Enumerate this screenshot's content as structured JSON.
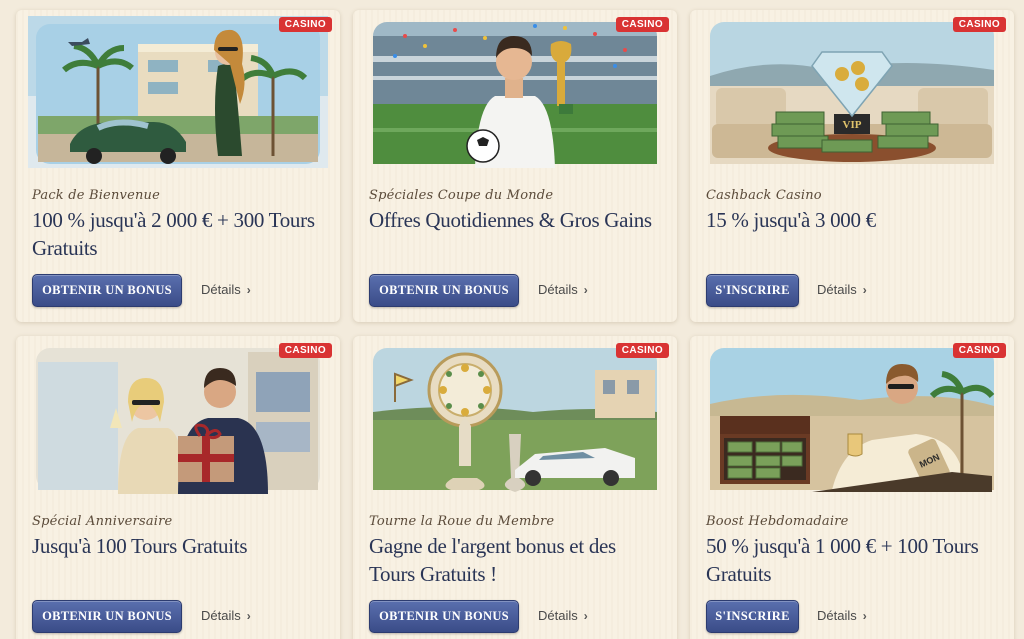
{
  "badge_label": "CASINO",
  "cards": [
    {
      "subtitle": "Pack de Bienvenue",
      "title": "100 % jusqu'à 2 000 € + 300 Tours Gratuits",
      "button": "OBTENIR UN BONUS",
      "details": "Détails"
    },
    {
      "subtitle": "Spéciales Coupe du Monde",
      "title": "Offres Quotidiennes & Gros Gains",
      "button": "OBTENIR UN BONUS",
      "details": "Détails"
    },
    {
      "subtitle": "Cashback Casino",
      "title": "15 % jusqu'à 3 000 €",
      "button": "S'INSCRIRE",
      "details": "Détails"
    },
    {
      "subtitle": "Spécial Anniversaire",
      "title": "Jusqu'à 100 Tours Gratuits",
      "button": "OBTENIR UN BONUS",
      "details": "Détails"
    },
    {
      "subtitle": "Tourne la Roue du Membre",
      "title": "Gagne de l'argent bonus et des Tours Gratuits !",
      "button": "OBTENIR UN BONUS",
      "details": "Détails"
    },
    {
      "subtitle": "Boost Hebdomadaire",
      "title": "50 % jusqu'à 1 000 € + 100 Tours Gratuits",
      "button": "S'INSCRIRE",
      "details": "Détails"
    }
  ],
  "vip_sign": "VIP",
  "mon_sign": "MON",
  "icons": {
    "details": "chevron-right-icon"
  },
  "colors": {
    "badge": "#d93333",
    "button": "#3f518e",
    "title": "#2a3556",
    "card": "#f8f1e3"
  }
}
